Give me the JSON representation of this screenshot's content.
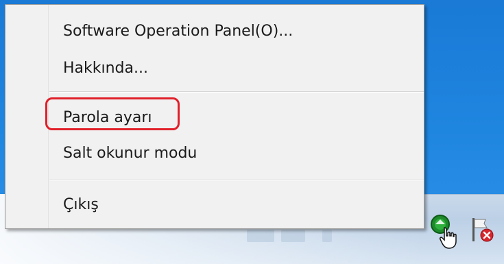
{
  "context_menu": {
    "items": [
      {
        "label": "Software Operation Panel(O)..."
      },
      {
        "label": "Hakkında..."
      },
      {
        "label": "Parola ayarı"
      },
      {
        "label": "Salt okunur modu"
      },
      {
        "label": "Çıkış"
      }
    ],
    "highlighted_item": "Parola ayarı",
    "highlight_color": "#e0202a"
  },
  "tray": {
    "icons": [
      "scanner-tray-icon",
      "action-center-flag-icon",
      "mouse-pointer-icon"
    ]
  },
  "colors": {
    "desktop": "#1f86e0",
    "menu_background": "#f1f1f1"
  }
}
